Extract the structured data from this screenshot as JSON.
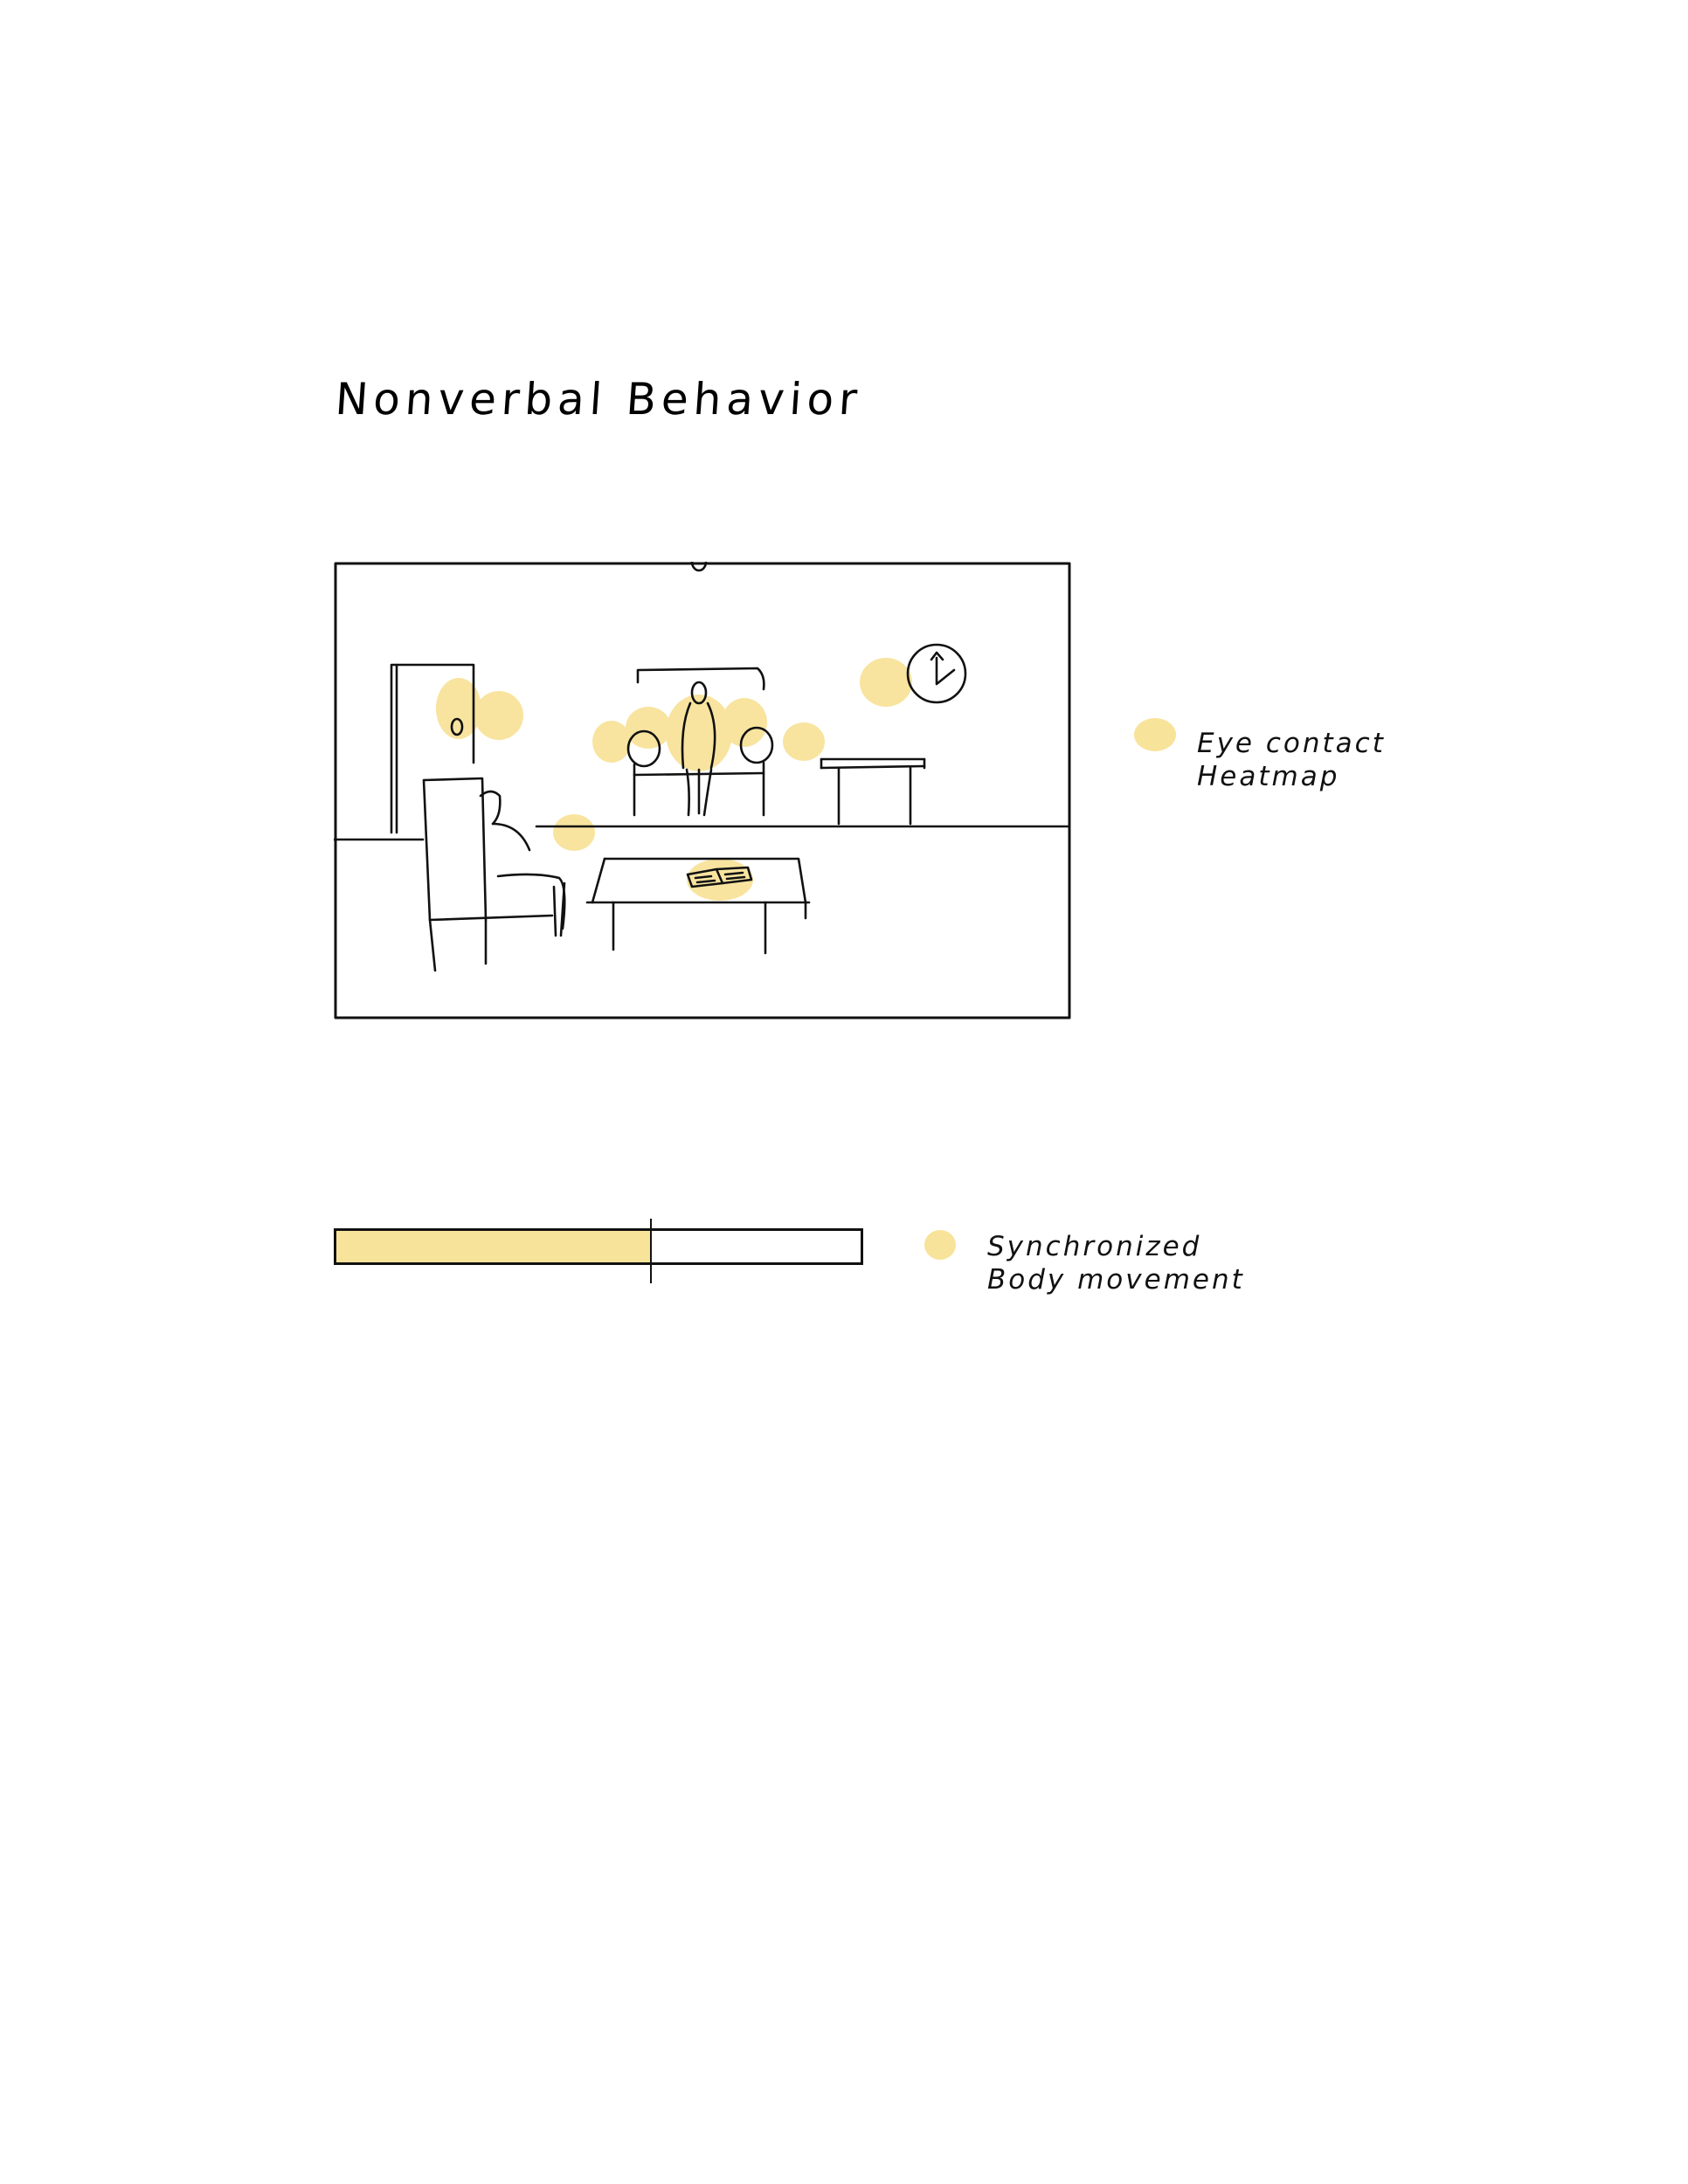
{
  "page": {
    "title": "Nonverbal Behavior",
    "highlight_color": "#f8e39a",
    "ink_color": "#111111"
  },
  "scene": {
    "icons": [
      "door-icon",
      "armchair-icon",
      "person-icon",
      "sofa-icon",
      "clock-icon",
      "side-table-icon",
      "coffee-table-icon",
      "book-icon"
    ]
  },
  "legend": {
    "eye_contact": {
      "line1": "Eye contact",
      "line2": "Heatmap"
    },
    "body_movement": {
      "line1": "Synchronized",
      "line2": "Body movement"
    }
  },
  "sync_bar": {
    "fill_fraction": 0.6
  }
}
